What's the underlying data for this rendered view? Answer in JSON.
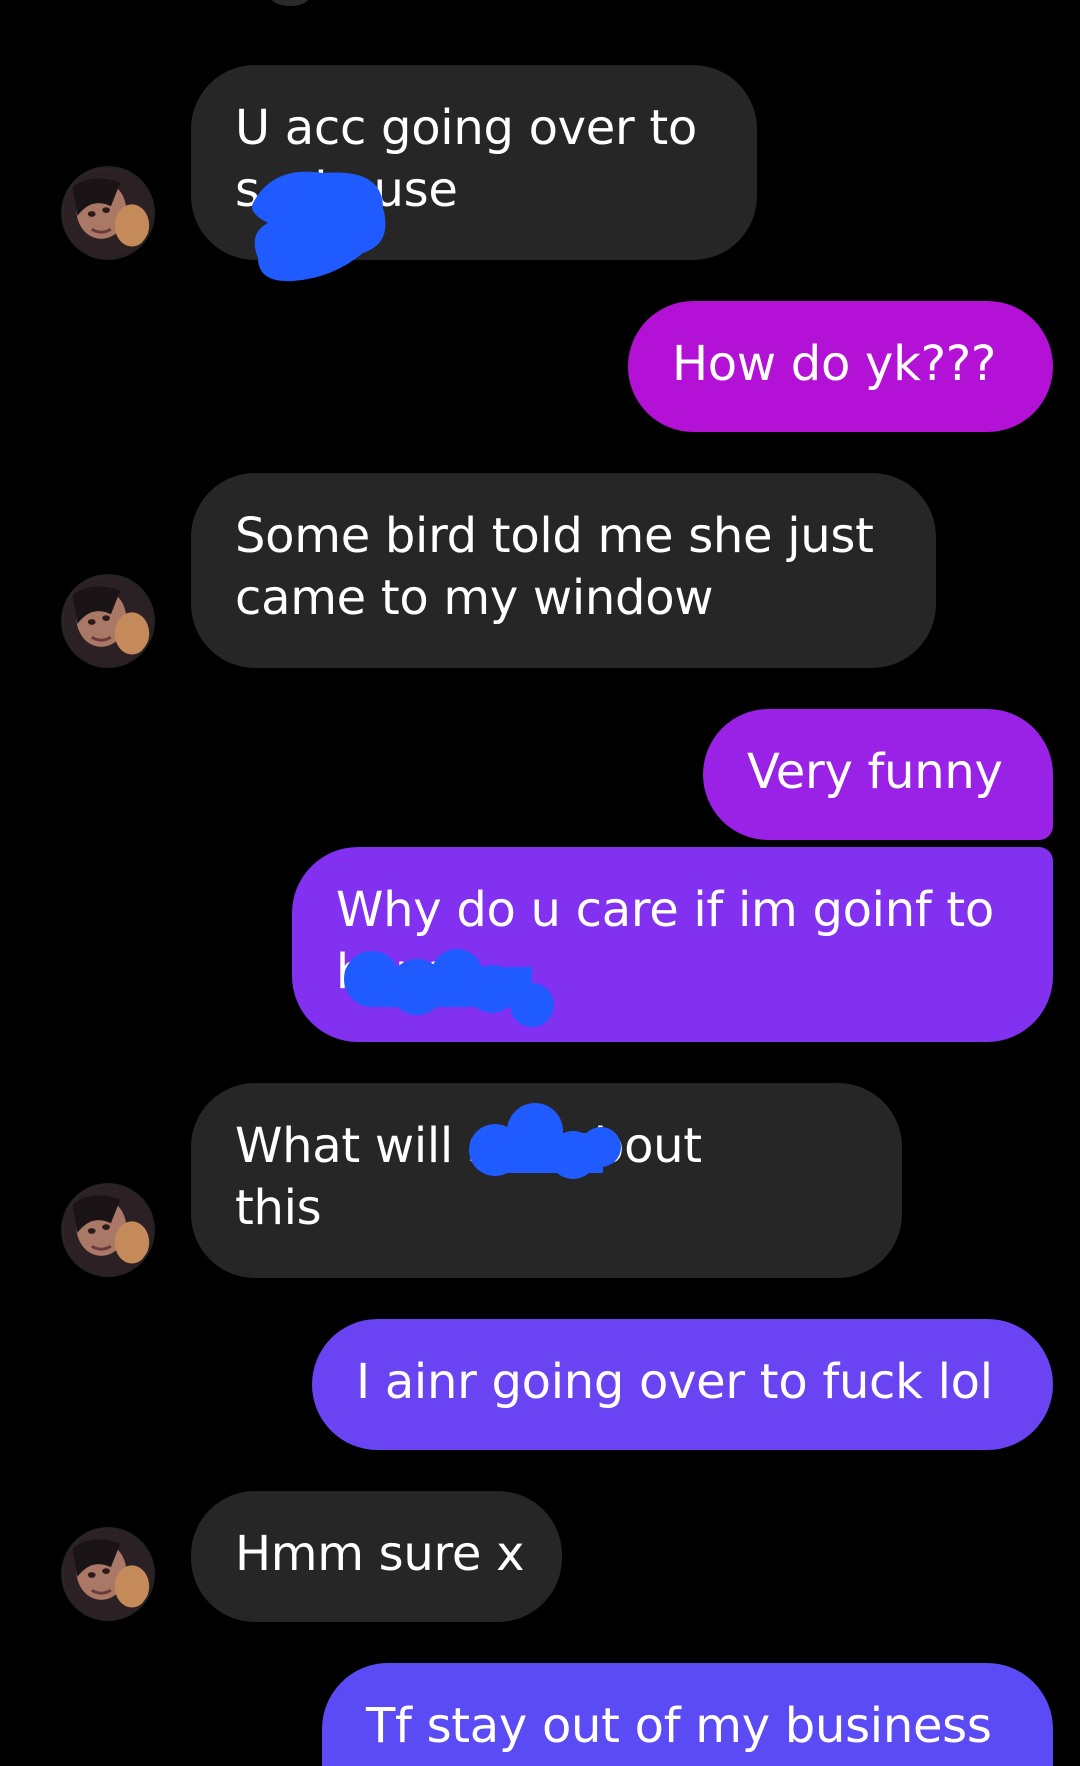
{
  "messages": [
    {
      "side": "in",
      "lines": [
        "U acc going over to",
        "s                 s house"
      ]
    },
    {
      "side": "out",
      "lines": [
        "How do yk???"
      ]
    },
    {
      "side": "in",
      "lines": [
        "Some bird told me she just",
        "came to my window"
      ]
    },
    {
      "side": "out",
      "lines": [
        "Very funny"
      ]
    },
    {
      "side": "out",
      "lines": [
        "Why do u care if im goinf to",
        "             house"
      ]
    },
    {
      "side": "in",
      "lines": [
        "What will              say about",
        "this"
      ]
    },
    {
      "side": "out",
      "lines": [
        "I ainr going over to fuck lol"
      ]
    },
    {
      "side": "in",
      "lines": [
        "Hmm sure x"
      ]
    },
    {
      "side": "out",
      "lines": [
        "Tf stay out of my business"
      ]
    }
  ],
  "colors": {
    "background": "#000000",
    "incoming_bubble": "#262626",
    "outgoing_gradient_top": "#b311d6",
    "outgoing_gradient_bottom": "#5b4bf5",
    "redaction": "#1f5bff",
    "text": "#ffffff"
  },
  "icons": {
    "avatar": "contact-avatar-photo"
  }
}
